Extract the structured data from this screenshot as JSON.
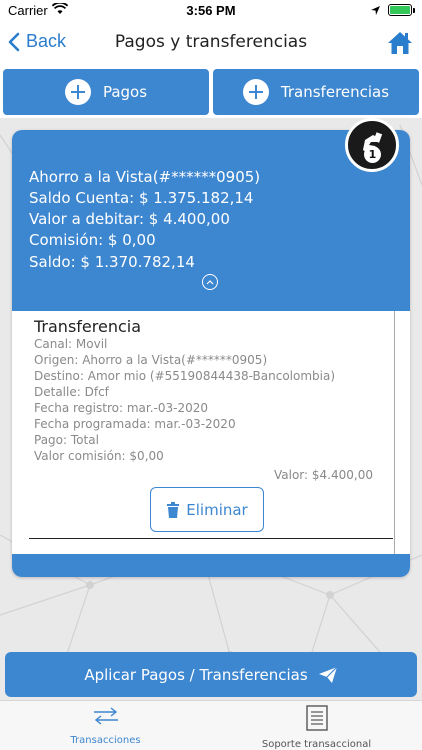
{
  "status_bar": {
    "carrier": "Carrier",
    "time": "3:56 PM"
  },
  "nav": {
    "back_label": "Back",
    "title": "Pagos y transferencias"
  },
  "top_actions": {
    "pagos_label": "Pagos",
    "transferencias_label": "Transferencias"
  },
  "card": {
    "badge_count": "1",
    "summary": [
      "Ahorro a la Vista(#******0905)",
      "Saldo Cuenta: $ 1.375.182,14",
      "Valor a debitar: $ 4.400,00",
      "Comisión: $ 0,00",
      "Saldo: $ 1.370.782,14"
    ],
    "detail": {
      "title": "Transferencia",
      "rows": [
        {
          "key": "Canal:",
          "value": "Movil"
        },
        {
          "key": "Origen:",
          "value": "Ahorro a la Vista(#******0905)"
        },
        {
          "key": "Destino:",
          "value": "Amor mio (#55190844438-Bancolombia)"
        },
        {
          "key": "Detalle:",
          "value": "Dfcf"
        },
        {
          "key": "Fecha registro:",
          "value": "mar.-03-2020"
        },
        {
          "key": "Fecha programada:",
          "value": "mar.-03-2020"
        },
        {
          "key": "Pago:",
          "value": "Total"
        },
        {
          "key": "Valor comisión:",
          "value": "$0,00"
        }
      ],
      "valor": "Valor: $4.400,00",
      "delete_label": "Eliminar"
    }
  },
  "apply_label": "Aplicar Pagos / Transferencias",
  "tabs": [
    {
      "label": "Transacciones"
    },
    {
      "label": "Soporte transaccional"
    }
  ],
  "colors": {
    "accent": "#3d86d0",
    "back_link": "#2a7ccc"
  }
}
